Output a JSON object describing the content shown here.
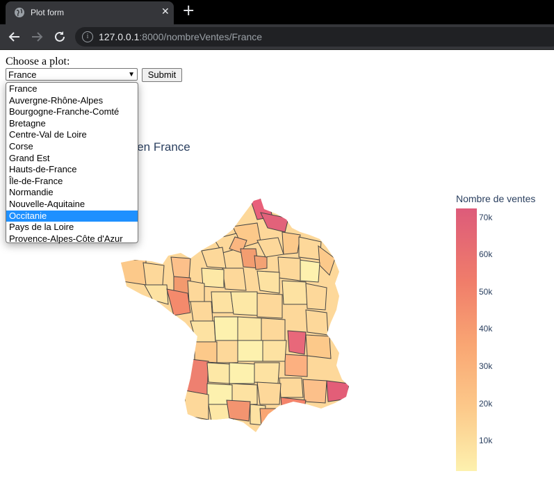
{
  "browser": {
    "tab_title": "Plot form",
    "tab_close": "✕",
    "new_tab": "+",
    "url_host": "127.0.0.1",
    "url_rest": ":8000/nombreVentes/France"
  },
  "form": {
    "label": "Choose a plot:",
    "selected": "France",
    "submit_label": "Submit",
    "options": [
      "France",
      "Auvergne-Rhône-Alpes",
      "Bourgogne-Franche-Comté",
      "Bretagne",
      "Centre-Val de Loire",
      "Corse",
      "Grand Est",
      "Hauts-de-France",
      "Île-de-France",
      "Normandie",
      "Nouvelle-Aquitaine",
      "Occitanie",
      "Pays de la Loire",
      "Provence-Alpes-Côte d'Azur"
    ],
    "highlighted_option": "Occitanie"
  },
  "plot": {
    "title_visible": "s en France",
    "colorbar_title": "Nombre de ventes",
    "colorbar_ticks": [
      "70k",
      "60k",
      "50k",
      "40k",
      "30k",
      "20k",
      "10k"
    ],
    "colorscale": [
      "#fdf1ae",
      "#fcc98a",
      "#f9a673",
      "#f07d6a",
      "#dd5b7a"
    ]
  }
}
